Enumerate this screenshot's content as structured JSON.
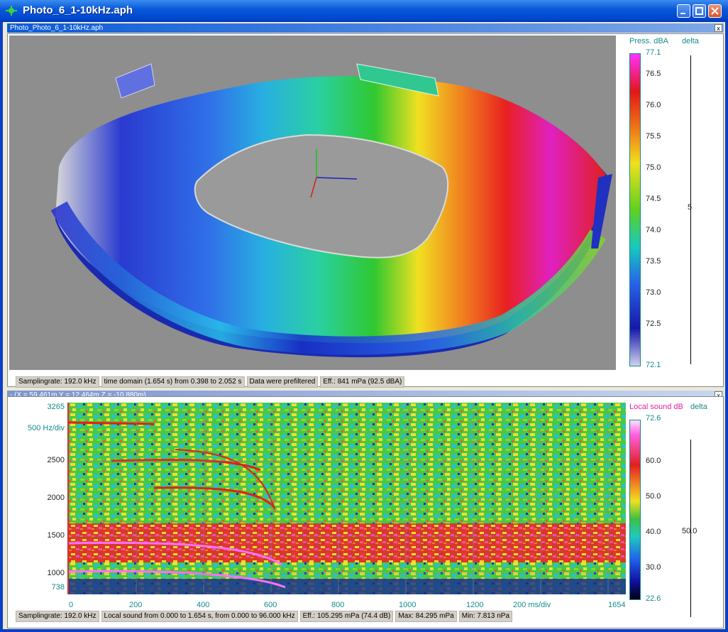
{
  "window": {
    "title": "Photo_6_1-10kHz.aph"
  },
  "top_pane": {
    "title": "Photo_Photo_6_1-10kHz.aph",
    "legend": {
      "label": "Press. dBA",
      "delta_label": "delta",
      "ticks": [
        "77.1",
        "76.5",
        "76.0",
        "75.5",
        "75.0",
        "74.5",
        "74.0",
        "73.5",
        "73.0",
        "72.5",
        "72.1"
      ],
      "delta_value": "5"
    },
    "status": [
      "Samplingrate: 192.0 kHz",
      "time domain (1.654 s) from 0.398 to 2.052 s",
      "Data were prefiltered",
      "Eff.: 841 mPa (92.5 dBA)"
    ]
  },
  "bottom_pane": {
    "title": "- (X = 59.461m Y = 12.464m Z = -10.880m)",
    "y_top": "3265",
    "y_div": "500 Hz/div",
    "y_ticks": [
      "2500",
      "2000",
      "1500",
      "1000"
    ],
    "y_bottom": "738",
    "x_ticks": [
      "0",
      "200",
      "400",
      "600",
      "800",
      "1000",
      "1200",
      "200 ms/div",
      "1654"
    ],
    "legend": {
      "label": "Local sound dB",
      "delta_label": "delta",
      "ticks": [
        "72.6",
        "60.0",
        "50.0",
        "40.0",
        "30.0",
        "22.6"
      ],
      "delta_value": "50.0"
    },
    "status": [
      "Samplingrate: 192.0 kHz",
      "Local sound from 0.000 to 1.654 s, from 0.000 to 96.000 kHz",
      "Eff.: 105.295 mPa  (74.4 dB)",
      "Max: 84.295 mPa",
      "Min: 7.813 nPa"
    ]
  },
  "colors": {
    "titlebar": "#0a5ad9",
    "legend_text": "#168a8a"
  }
}
